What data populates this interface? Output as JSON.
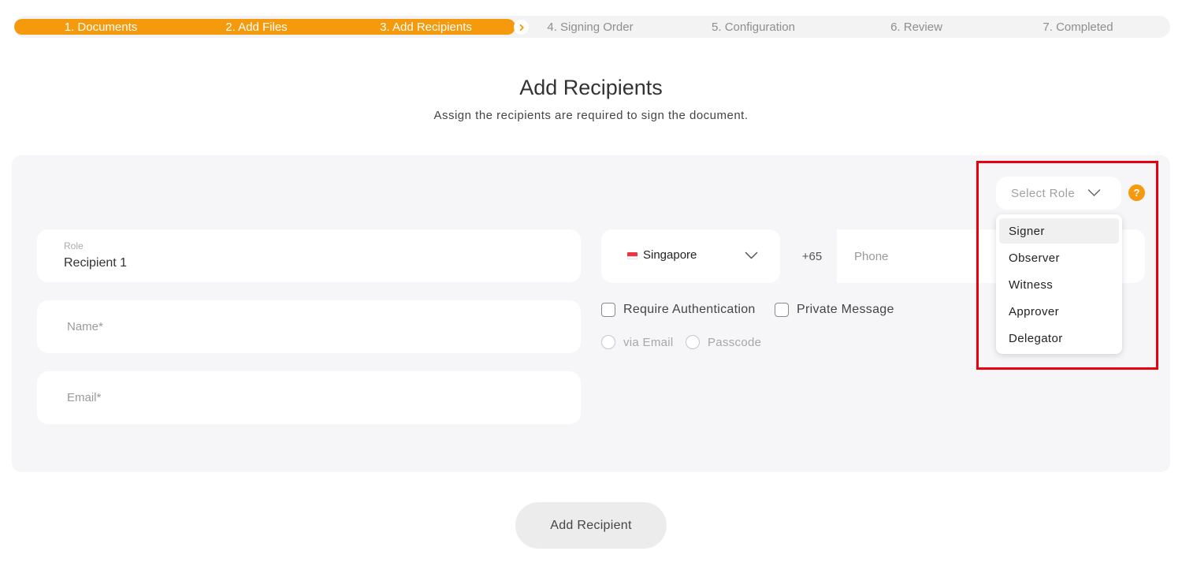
{
  "stepper": {
    "steps": [
      {
        "label": "1. Documents",
        "state": "done"
      },
      {
        "label": "2. Add Files",
        "state": "done"
      },
      {
        "label": "3. Add Recipients",
        "state": "current"
      },
      {
        "label": "4. Signing Order",
        "state": "upcoming"
      },
      {
        "label": "5. Configuration",
        "state": "upcoming"
      },
      {
        "label": "6. Review",
        "state": "upcoming"
      },
      {
        "label": "7. Completed",
        "state": "upcoming"
      }
    ],
    "accent_color": "#f59a0c"
  },
  "header": {
    "title": "Add Recipients",
    "subtitle": "Assign the recipients are required to sign the document."
  },
  "recipient": {
    "role_label": "Role",
    "role_value": "Recipient 1",
    "name_placeholder": "Name*",
    "email_placeholder": "Email*",
    "country": "Singapore",
    "country_flag_icon": "singapore-flag-icon",
    "dial_code": "+65",
    "phone_placeholder": "Phone",
    "require_auth_label": "Require Authentication",
    "private_message_label": "Private Message",
    "via_email_label": "via Email",
    "passcode_label": "Passcode"
  },
  "role_select": {
    "placeholder": "Select Role",
    "help_icon": "?",
    "options": [
      "Signer",
      "Observer",
      "Witness",
      "Approver",
      "Delegator"
    ],
    "hovered_option": "Signer"
  },
  "actions": {
    "add_recipient_label": "Add Recipient"
  },
  "colors": {
    "highlight_box": "#e8000f",
    "panel_bg": "#f6f6f8"
  }
}
